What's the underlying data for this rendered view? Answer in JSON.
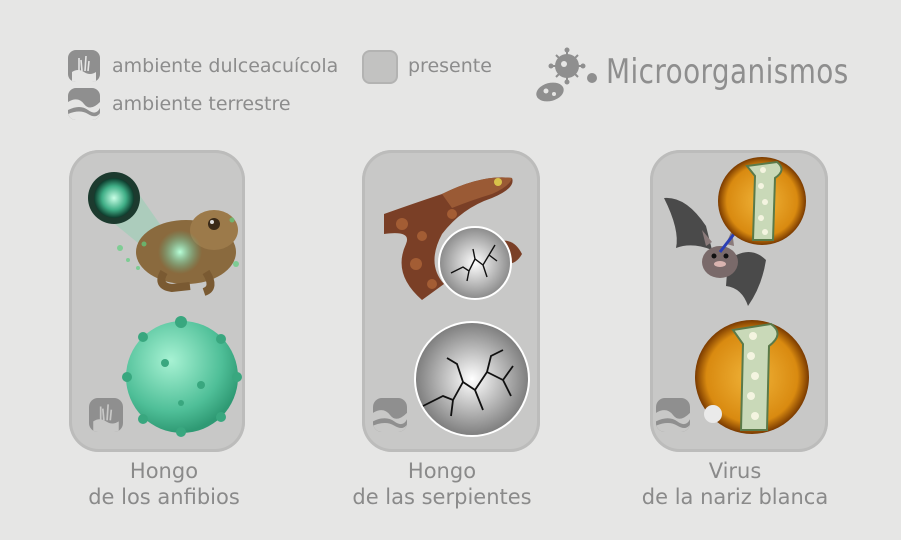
{
  "legend": {
    "freshwater_label": "ambiente dulceacuícola",
    "terrestrial_label": "ambiente terrestre",
    "present_label": "presente",
    "freshwater_icon": "freshwater-environment-icon",
    "terrestrial_icon": "terrestrial-environment-icon"
  },
  "title": "Microorganismos",
  "cards": [
    {
      "line1": "Hongo",
      "line2": "de los anfibios",
      "environment_icon": "freshwater-environment-icon"
    },
    {
      "line1": "Hongo",
      "line2": "de las serpientes",
      "environment_icon": "terrestrial-environment-icon"
    },
    {
      "line1": "Virus",
      "line2": "de la nariz blanca",
      "environment_icon": "terrestrial-environment-icon"
    }
  ],
  "colors": {
    "background": "#e6e6e5",
    "card": "#c8c8c7",
    "icon": "#8f8f8f",
    "text": "#8a8a8a",
    "fungus_green": "#4fbf98",
    "virus_orange": "#d98a10"
  }
}
